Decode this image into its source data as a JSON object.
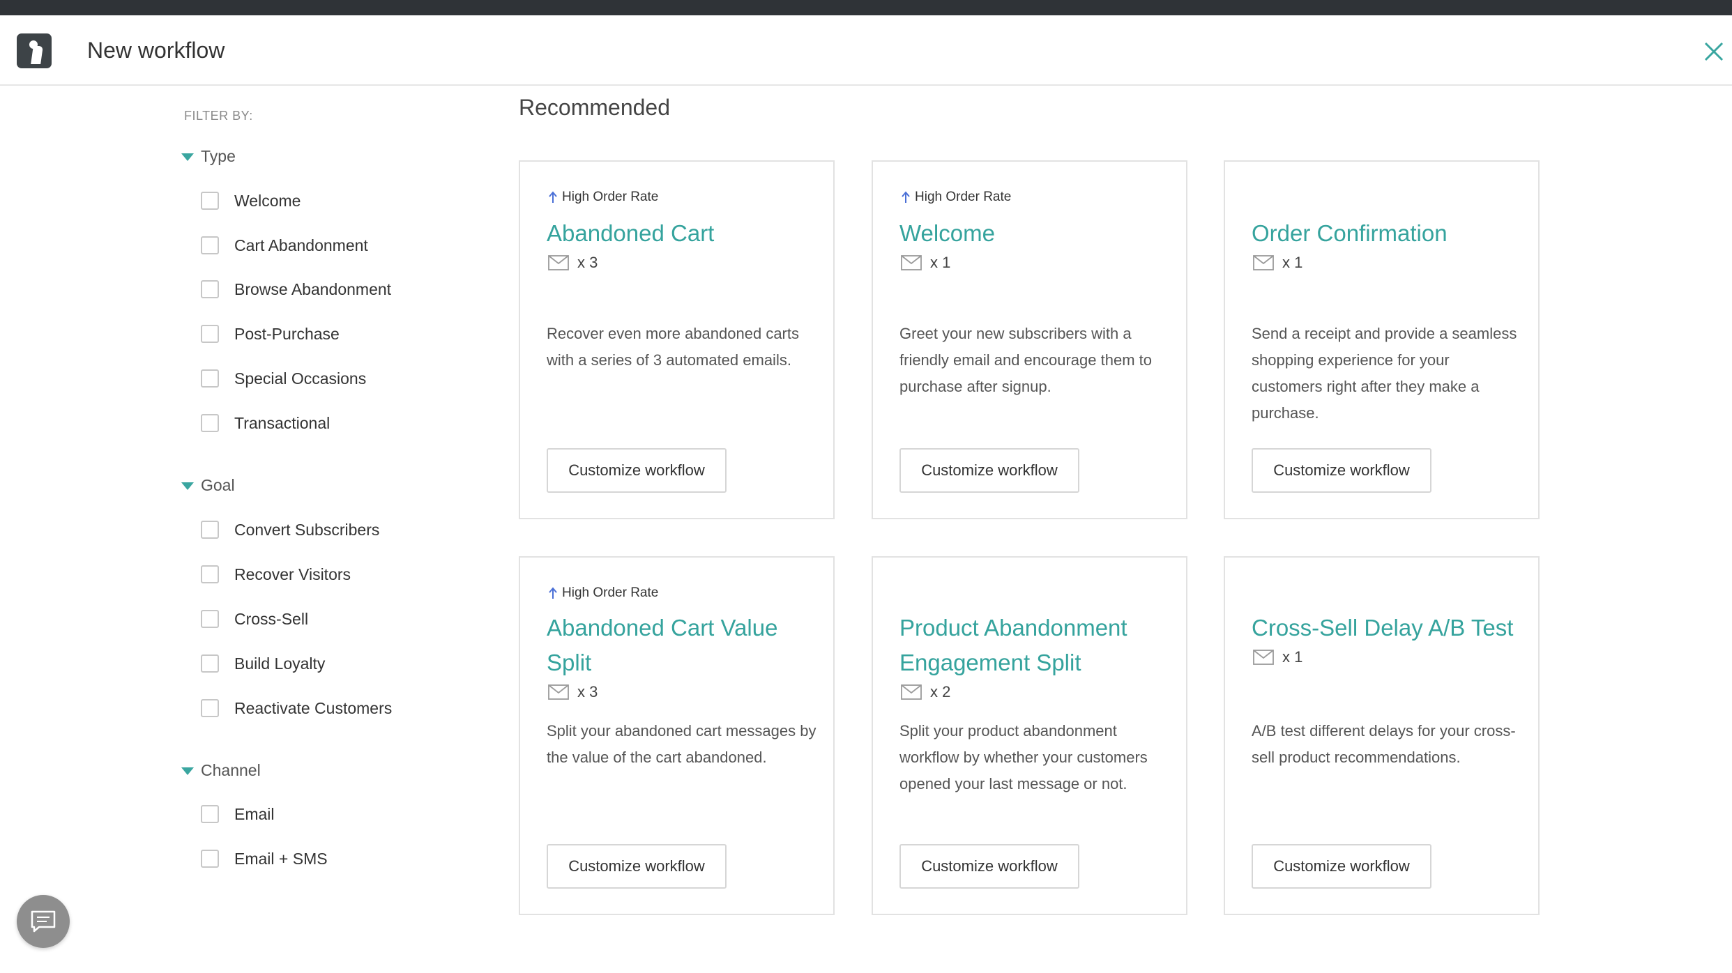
{
  "header": {
    "title": "New workflow"
  },
  "sidebar": {
    "filter_by": "FILTER BY:",
    "groups": [
      {
        "label": "Type",
        "options": [
          "Welcome",
          "Cart Abandonment",
          "Browse Abandonment",
          "Post-Purchase",
          "Special Occasions",
          "Transactional"
        ]
      },
      {
        "label": "Goal",
        "options": [
          "Convert Subscribers",
          "Recover Visitors",
          "Cross-Sell",
          "Build Loyalty",
          "Reactivate Customers"
        ]
      },
      {
        "label": "Channel",
        "options": [
          "Email",
          "Email + SMS"
        ]
      }
    ]
  },
  "main": {
    "section_title": "Recommended",
    "cards": [
      {
        "badge": "High Order Rate",
        "title": "Abandoned Cart",
        "email_count": "x 3",
        "description": "Recover even more abandoned carts with a series of 3 automated emails.",
        "button": "Customize workflow"
      },
      {
        "badge": "High Order Rate",
        "title": "Welcome",
        "email_count": "x 1",
        "description": "Greet your new subscribers with a friendly email and encourage them to purchase after signup.",
        "button": "Customize workflow"
      },
      {
        "badge": "",
        "title": "Order Confirmation",
        "email_count": "x 1",
        "description": "Send a receipt and provide a seamless shopping experience for your customers right after they make a purchase.",
        "button": "Customize workflow"
      },
      {
        "badge": "High Order Rate",
        "title": "Abandoned Cart Value Split",
        "email_count": "x 3",
        "description": "Split your abandoned cart messages by the value of the cart abandoned.",
        "button": "Customize workflow"
      },
      {
        "badge": "",
        "title": "Product Abandonment Engagement Split",
        "email_count": "x 2",
        "description": "Split your product abandonment workflow by whether your customers opened your last message or not.",
        "button": "Customize workflow"
      },
      {
        "badge": "",
        "title": "Cross-Sell Delay A/B Test",
        "email_count": "x 1",
        "description": "A/B test different delays for your cross-sell product recommendations.",
        "button": "Customize workflow"
      }
    ]
  },
  "colors": {
    "accent": "#35a39d",
    "badge_arrow": "#4a6fd6",
    "topbar": "#2f3337"
  }
}
